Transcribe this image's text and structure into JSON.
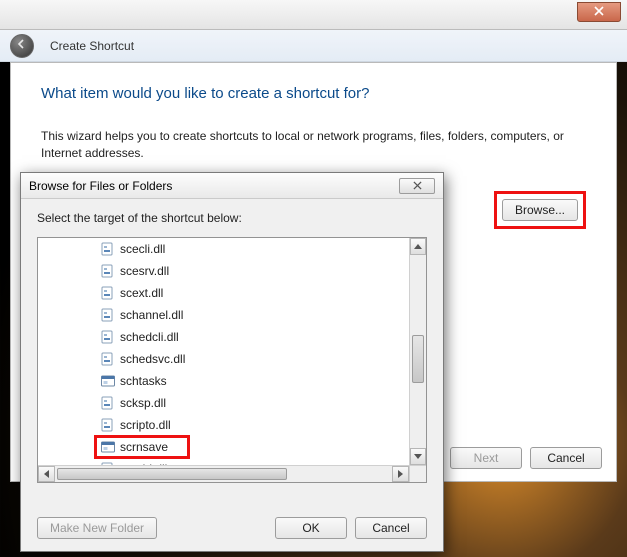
{
  "wizard": {
    "title": "Create Shortcut",
    "question": "What item would you like to create a shortcut for?",
    "description": "This wizard helps you to create shortcuts to local or network programs, files, folders, computers, or Internet addresses.",
    "browse_label": "Browse...",
    "next_label": "Next",
    "cancel_label": "Cancel"
  },
  "browse": {
    "title": "Browse for Files or Folders",
    "instruction": "Select the target of the shortcut below:",
    "items": [
      {
        "name": "scecli.dll",
        "type": "dll"
      },
      {
        "name": "scesrv.dll",
        "type": "dll"
      },
      {
        "name": "scext.dll",
        "type": "dll"
      },
      {
        "name": "schannel.dll",
        "type": "dll"
      },
      {
        "name": "schedcli.dll",
        "type": "dll"
      },
      {
        "name": "schedsvc.dll",
        "type": "dll"
      },
      {
        "name": "schtasks",
        "type": "exe"
      },
      {
        "name": "scksp.dll",
        "type": "dll"
      },
      {
        "name": "scripto.dll",
        "type": "dll"
      },
      {
        "name": "scrnsave",
        "type": "exe",
        "highlighted": true
      },
      {
        "name": "scrobj.dll",
        "type": "dll"
      }
    ],
    "make_new_folder_label": "Make New Folder",
    "ok_label": "OK",
    "cancel_label": "Cancel"
  }
}
